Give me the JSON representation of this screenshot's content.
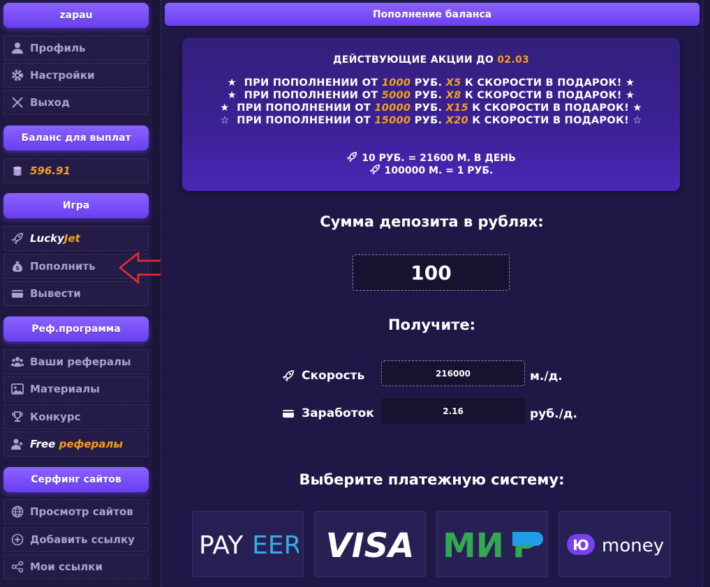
{
  "sidebar": {
    "user_header": "zapau",
    "account": [
      {
        "label": "Профиль",
        "icon": "user-icon"
      },
      {
        "label": "Настройки",
        "icon": "gear-icon"
      },
      {
        "label": "Выход",
        "icon": "close-icon"
      }
    ],
    "balance_header": "Баланс для выплат",
    "balance_value": "596.91",
    "game_header": "Игра",
    "game": {
      "luckyjet_part1": "Lucky",
      "luckyjet_part2": "Jet",
      "topup": "Пополнить",
      "withdraw": "Вывести"
    },
    "ref_header": "Реф.программа",
    "ref": {
      "referrals": "Ваши рефералы",
      "materials": "Материалы",
      "contest": "Конкурс",
      "free_part1": "Free",
      "free_part2": "рефералы"
    },
    "surf_header": "Серфинг сайтов",
    "surf": {
      "view": "Просмотр сайтов",
      "add": "Добавить ссылку",
      "links": "Мои ссылки"
    }
  },
  "main": {
    "title": "Пополнение баланса",
    "promo": {
      "title_prefix": "ДЕЙСТВУЮЩИЕ АКЦИИ ДО",
      "title_date": "02.03",
      "lines": [
        {
          "star": "★",
          "pre": "ПРИ ПОПОЛНЕНИИ ОТ",
          "amount": "1000",
          "mid": "РУБ.",
          "mult": "X5",
          "post": "К СКОРОСТИ В ПОДАРОК!",
          "star_end": "★"
        },
        {
          "star": "★",
          "pre": "ПРИ ПОПОЛНЕНИИ ОТ",
          "amount": "5000",
          "mid": "РУБ.",
          "mult": "X8",
          "post": "К СКОРОСТИ В ПОДАРОК!",
          "star_end": "★"
        },
        {
          "star": "★",
          "pre": "ПРИ ПОПОЛНЕНИИ ОТ",
          "amount": "10000",
          "mid": "РУБ.",
          "mult": "X15",
          "post": "К СКОРОСТИ В ПОДАРОК!",
          "star_end": "★"
        },
        {
          "star": "☆",
          "pre": "ПРИ ПОПОЛНЕНИИ ОТ",
          "amount": "15000",
          "mid": "РУБ.",
          "mult": "X20",
          "post": "К СКОРОСТИ В ПОДАРОК!",
          "star_end": "☆"
        }
      ],
      "rate1": "10 РУБ. = 21600 М. В ДЕНЬ",
      "rate2": "100000 М. = 1 РУБ."
    },
    "deposit_label": "Сумма депозита в рублях:",
    "deposit_value": "100",
    "receive_label": "Получите:",
    "speed_label": "Скорость",
    "speed_value": "216000",
    "speed_unit": "м./д.",
    "earn_label": "Заработок",
    "earn_value": "2.16",
    "earn_unit": "руб./д.",
    "pay_label": "Выберите платежную систему:",
    "payments": {
      "payeer_a": "PAY",
      "payeer_b": "EER",
      "visa": "VISA",
      "mir_a": "МИ",
      "mir_b": "Р",
      "yoomoney": "money",
      "yoo_badge": "Ю"
    }
  },
  "colors": {
    "accent_purple": "#7a52ff",
    "highlight_orange": "#f4a020",
    "background": "#1b1538",
    "arrow_red": "#e53030"
  }
}
